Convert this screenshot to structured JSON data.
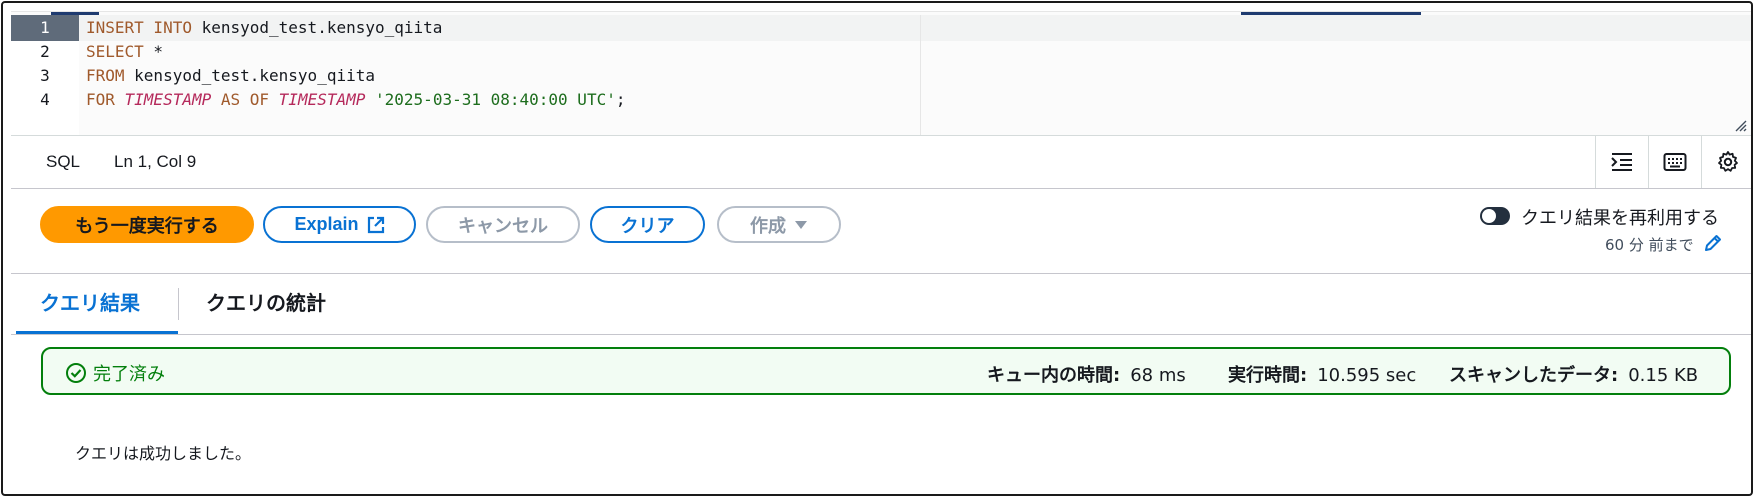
{
  "editor": {
    "line_numbers": [
      "1",
      "2",
      "3",
      "4"
    ],
    "lines": [
      [
        {
          "t": "kw",
          "v": "INSERT INTO "
        },
        {
          "t": "plain",
          "v": "kensyod_test.kensyo_qiita"
        }
      ],
      [
        {
          "t": "kw",
          "v": "SELECT"
        },
        {
          "t": "plain",
          "v": " *"
        }
      ],
      [
        {
          "t": "kw",
          "v": "FROM"
        },
        {
          "t": "plain",
          "v": " kensyod_test.kensyo_qiita"
        }
      ],
      [
        {
          "t": "kw",
          "v": "FOR "
        },
        {
          "t": "fn",
          "v": "TIMESTAMP"
        },
        {
          "t": "kw",
          "v": " AS OF "
        },
        {
          "t": "fn",
          "v": "TIMESTAMP"
        },
        {
          "t": "plain",
          "v": " "
        },
        {
          "t": "str",
          "v": "'2025-03-31 08:40:00 UTC'"
        },
        {
          "t": "plain",
          "v": ";"
        }
      ]
    ]
  },
  "statusbar": {
    "language": "SQL",
    "cursor": "Ln 1, Col 9",
    "icons": [
      "indent-icon",
      "keyboard-icon",
      "gear-icon"
    ]
  },
  "actions": {
    "run": "もう一度実行する",
    "explain": "Explain",
    "cancel": "キャンセル",
    "clear": "クリア",
    "create": "作成"
  },
  "reuse": {
    "label": "クエリ結果を再利用する",
    "age": "60 分 前まで",
    "enabled": false
  },
  "tabs": {
    "results": "クエリ結果",
    "stats": "クエリの統計"
  },
  "status": {
    "text": "完了済み",
    "queue_label": "キュー内の時間:",
    "queue_value": "68 ms",
    "exec_label": "実行時間:",
    "exec_value": "10.595 sec",
    "scan_label": "スキャンしたデータ:",
    "scan_value": "0.15 KB"
  },
  "result_message": "クエリは成功しました。",
  "colors": {
    "primary": "#ff9900",
    "link_blue": "#0972d3",
    "success_green": "#037f0c"
  }
}
